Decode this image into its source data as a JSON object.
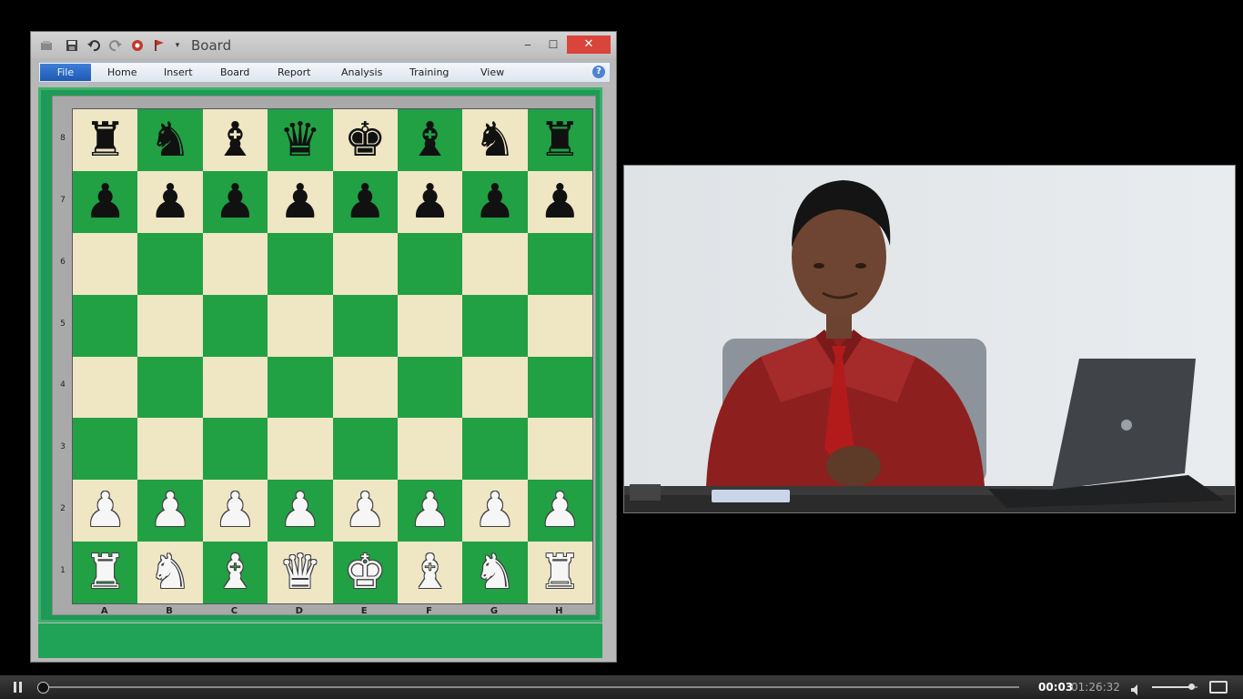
{
  "window": {
    "title": "Board",
    "quick_access_icons": [
      "app-logo-icon",
      "save-icon",
      "undo-icon",
      "redo-icon",
      "engine-icon",
      "flag-icon",
      "dropdown-icon"
    ],
    "controls": {
      "minimize": "‒",
      "maximize": "☐",
      "close": "✕"
    }
  },
  "ribbon": {
    "tabs": [
      "File",
      "Home",
      "Insert",
      "Board",
      "Report",
      "Analysis",
      "Training",
      "View"
    ],
    "help": "?"
  },
  "board": {
    "ranks": [
      "8",
      "7",
      "6",
      "5",
      "4",
      "3",
      "2",
      "1"
    ],
    "files": [
      "A",
      "B",
      "C",
      "D",
      "E",
      "F",
      "G",
      "H"
    ],
    "position": [
      [
        "r",
        "n",
        "b",
        "q",
        "k",
        "b",
        "n",
        "r"
      ],
      [
        "p",
        "p",
        "p",
        "p",
        "p",
        "p",
        "p",
        "p"
      ],
      [
        "",
        "",
        "",
        "",
        "",
        "",
        "",
        ""
      ],
      [
        "",
        "",
        "",
        "",
        "",
        "",
        "",
        ""
      ],
      [
        "",
        "",
        "",
        "",
        "",
        "",
        "",
        ""
      ],
      [
        "",
        "",
        "",
        "",
        "",
        "",
        "",
        ""
      ],
      [
        "P",
        "P",
        "P",
        "P",
        "P",
        "P",
        "P",
        "P"
      ],
      [
        "R",
        "N",
        "B",
        "Q",
        "K",
        "B",
        "N",
        "R"
      ]
    ],
    "colors": {
      "light": "#efe6c4",
      "dark": "#21a044"
    }
  },
  "player": {
    "current_time": "00:03",
    "total_time": "01:26:32",
    "progress": 0.0006,
    "volume": 0.85
  }
}
